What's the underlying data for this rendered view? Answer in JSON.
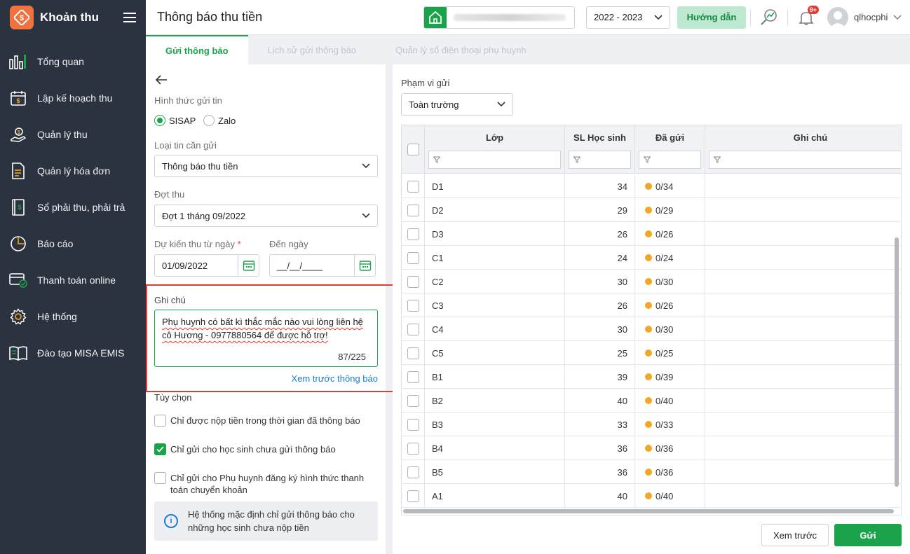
{
  "sidebar": {
    "brand": "Khoản thu",
    "items": [
      {
        "label": "Tổng quan",
        "icon": "bar-chart-icon"
      },
      {
        "label": "Lập kế hoạch thu",
        "icon": "calendar-money-icon"
      },
      {
        "label": "Quản lý thu",
        "icon": "hand-coin-icon"
      },
      {
        "label": "Quản lý hóa đơn",
        "icon": "invoice-icon"
      },
      {
        "label": "Sổ phải thu, phải trả",
        "icon": "ledger-icon"
      },
      {
        "label": "Báo cáo",
        "icon": "pie-chart-icon"
      },
      {
        "label": "Thanh toán online",
        "icon": "card-payment-icon"
      },
      {
        "label": "Hệ thống",
        "icon": "gear-icon"
      },
      {
        "label": "Đào tạo MISA EMIS",
        "icon": "book-icon"
      }
    ]
  },
  "header": {
    "title": "Thông báo thu tiền",
    "year": "2022 - 2023",
    "guide": "Hướng dẫn",
    "badge": "9+",
    "user": "qlhocphi"
  },
  "tabs": [
    "Gửi thông báo",
    "Lịch sử gửi thông báo",
    "Quản lý số điện thoại phụ huynh"
  ],
  "form": {
    "send_method_label": "Hình thức gửi tin",
    "method_sisap": "SISAP",
    "method_zalo": "Zalo",
    "type_label": "Loại tin cần gửi",
    "type_value": "Thông báo thu tiền",
    "period_label": "Đợt thu",
    "period_value": "Đợt 1 tháng 09/2022",
    "from_label": "Dự kiến thu từ ngày",
    "required_mark": "*",
    "from_value": "01/09/2022",
    "to_label": "Đến ngày",
    "to_value": "__/__/____",
    "note_label": "Ghi chú",
    "note_value": "Phụ huynh có bất kì thắc mắc nào vui lòng liên hệ cô Hương - 0977880564 để được hỗ trợ!",
    "note_counter": "87/225",
    "preview_link": "Xem trước thông báo",
    "options_label": "Tùy chọn",
    "opt1": "Chỉ được nộp tiền trong thời gian đã thông báo",
    "opt2": "Chỉ gửi cho học sinh chưa gửi thông báo",
    "opt3": "Chỉ gửi cho Phụ huynh đăng ký hình thức thanh toán chuyển khoản",
    "info": "Hệ thống mặc định chỉ gửi thông báo cho những học sinh chưa nộp tiền"
  },
  "scope": {
    "label": "Phạm vi gửi",
    "value": "Toàn trường"
  },
  "table": {
    "headers": [
      "Lớp",
      "SL Học sinh",
      "Đã gửi",
      "Ghi chú"
    ],
    "rows": [
      {
        "class": "D1",
        "count": "34",
        "sent": "0/34"
      },
      {
        "class": "D2",
        "count": "29",
        "sent": "0/29"
      },
      {
        "class": "D3",
        "count": "26",
        "sent": "0/26"
      },
      {
        "class": "C1",
        "count": "24",
        "sent": "0/24"
      },
      {
        "class": "C2",
        "count": "30",
        "sent": "0/30"
      },
      {
        "class": "C3",
        "count": "26",
        "sent": "0/26"
      },
      {
        "class": "C4",
        "count": "30",
        "sent": "0/30"
      },
      {
        "class": "C5",
        "count": "25",
        "sent": "0/25"
      },
      {
        "class": "B1",
        "count": "39",
        "sent": "0/39"
      },
      {
        "class": "B2",
        "count": "40",
        "sent": "0/40"
      },
      {
        "class": "B3",
        "count": "33",
        "sent": "0/33"
      },
      {
        "class": "B4",
        "count": "36",
        "sent": "0/36"
      },
      {
        "class": "B5",
        "count": "36",
        "sent": "0/36"
      },
      {
        "class": "A1",
        "count": "40",
        "sent": "0/40"
      }
    ]
  },
  "buttons": {
    "preview": "Xem trước",
    "send": "Gửi"
  },
  "colors": {
    "accent": "#1aa34a",
    "sidebar": "#2b3340",
    "highlight": "#e53935",
    "pending": "#f5a623"
  }
}
